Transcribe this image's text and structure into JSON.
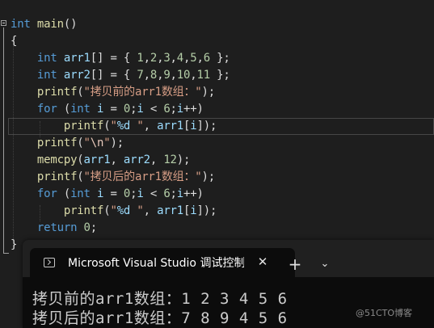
{
  "editor": {
    "lines": [
      [
        {
          "t": "int",
          "c": "kw"
        },
        {
          "t": " "
        },
        {
          "t": "main",
          "c": "fn"
        },
        {
          "t": "()"
        }
      ],
      [
        {
          "t": "{"
        }
      ],
      [
        {
          "t": "    "
        },
        {
          "t": "int",
          "c": "kw"
        },
        {
          "t": " "
        },
        {
          "t": "arr1",
          "c": "var"
        },
        {
          "t": "[] = { "
        },
        {
          "t": "1",
          "c": "num"
        },
        {
          "t": ","
        },
        {
          "t": "2",
          "c": "num"
        },
        {
          "t": ","
        },
        {
          "t": "3",
          "c": "num"
        },
        {
          "t": ","
        },
        {
          "t": "4",
          "c": "num"
        },
        {
          "t": ","
        },
        {
          "t": "5",
          "c": "num"
        },
        {
          "t": ","
        },
        {
          "t": "6",
          "c": "num"
        },
        {
          "t": " };"
        }
      ],
      [
        {
          "t": "    "
        },
        {
          "t": "int",
          "c": "kw"
        },
        {
          "t": " "
        },
        {
          "t": "arr2",
          "c": "var"
        },
        {
          "t": "[] = { "
        },
        {
          "t": "7",
          "c": "num"
        },
        {
          "t": ","
        },
        {
          "t": "8",
          "c": "num"
        },
        {
          "t": ","
        },
        {
          "t": "9",
          "c": "num"
        },
        {
          "t": ","
        },
        {
          "t": "10",
          "c": "num"
        },
        {
          "t": ","
        },
        {
          "t": "11",
          "c": "num"
        },
        {
          "t": " };"
        }
      ],
      [
        {
          "t": "    "
        },
        {
          "t": "printf",
          "c": "fn"
        },
        {
          "t": "("
        },
        {
          "t": "\"拷贝前的arr1数组：\"",
          "c": "str"
        },
        {
          "t": ");"
        }
      ],
      [
        {
          "t": "    "
        },
        {
          "t": "for",
          "c": "kw"
        },
        {
          "t": " ("
        },
        {
          "t": "int",
          "c": "kw"
        },
        {
          "t": " "
        },
        {
          "t": "i",
          "c": "var"
        },
        {
          "t": " = "
        },
        {
          "t": "0",
          "c": "num"
        },
        {
          "t": ";"
        },
        {
          "t": "i",
          "c": "var"
        },
        {
          "t": " < "
        },
        {
          "t": "6",
          "c": "num"
        },
        {
          "t": ";"
        },
        {
          "t": "i",
          "c": "var"
        },
        {
          "t": "++)"
        }
      ],
      [
        {
          "t": "        "
        },
        {
          "t": "printf",
          "c": "fn"
        },
        {
          "t": "("
        },
        {
          "t": "\"",
          "c": "str"
        },
        {
          "t": "%d",
          "c": "fmt"
        },
        {
          "t": " \"",
          "c": "str"
        },
        {
          "t": ", "
        },
        {
          "t": "arr1",
          "c": "var"
        },
        {
          "t": "["
        },
        {
          "t": "i",
          "c": "var"
        },
        {
          "t": "]);"
        }
      ],
      [
        {
          "t": "    "
        },
        {
          "t": "printf",
          "c": "fn"
        },
        {
          "t": "("
        },
        {
          "t": "\"",
          "c": "str"
        },
        {
          "t": "\\n",
          "c": "esc"
        },
        {
          "t": "\"",
          "c": "str"
        },
        {
          "t": ");"
        }
      ],
      [
        {
          "t": "    "
        },
        {
          "t": "memcpy",
          "c": "fn"
        },
        {
          "t": "("
        },
        {
          "t": "arr1",
          "c": "var"
        },
        {
          "t": ", "
        },
        {
          "t": "arr2",
          "c": "var"
        },
        {
          "t": ", "
        },
        {
          "t": "12",
          "c": "num"
        },
        {
          "t": ");"
        }
      ],
      [
        {
          "t": "    "
        },
        {
          "t": "printf",
          "c": "fn"
        },
        {
          "t": "("
        },
        {
          "t": "\"拷贝后的arr1数组：\"",
          "c": "str"
        },
        {
          "t": ");"
        }
      ],
      [
        {
          "t": "    "
        },
        {
          "t": "for",
          "c": "kw"
        },
        {
          "t": " ("
        },
        {
          "t": "int",
          "c": "kw"
        },
        {
          "t": " "
        },
        {
          "t": "i",
          "c": "var"
        },
        {
          "t": " = "
        },
        {
          "t": "0",
          "c": "num"
        },
        {
          "t": ";"
        },
        {
          "t": "i",
          "c": "var"
        },
        {
          "t": " < "
        },
        {
          "t": "6",
          "c": "num"
        },
        {
          "t": ";"
        },
        {
          "t": "i",
          "c": "var"
        },
        {
          "t": "++)"
        }
      ],
      [
        {
          "t": "        "
        },
        {
          "t": "printf",
          "c": "fn"
        },
        {
          "t": "("
        },
        {
          "t": "\"",
          "c": "str"
        },
        {
          "t": "%d",
          "c": "fmt"
        },
        {
          "t": " \"",
          "c": "str"
        },
        {
          "t": ", "
        },
        {
          "t": "arr1",
          "c": "var"
        },
        {
          "t": "["
        },
        {
          "t": "i",
          "c": "var"
        },
        {
          "t": "]);"
        }
      ],
      [
        {
          "t": "    "
        },
        {
          "t": "return",
          "c": "kw"
        },
        {
          "t": " "
        },
        {
          "t": "0",
          "c": "num"
        },
        {
          "t": ";"
        }
      ],
      [
        {
          "t": "}"
        }
      ]
    ]
  },
  "terminal": {
    "tab_title": "Microsoft Visual Studio 调试控制台",
    "close_glyph": "✕",
    "new_tab_glyph": "+",
    "dropdown_glyph": "⌄",
    "output_lines": [
      "拷贝前的arr1数组：1 2 3 4 5 6",
      "拷贝后的arr1数组：7 8 9 4 5 6"
    ]
  },
  "watermark": "@51CTO博客",
  "colors": {
    "editor_bg": "#1e1e1e",
    "keyword": "#569cd6",
    "function": "#dcdcaa",
    "variable": "#9cdcfe",
    "number": "#b5cea8",
    "string": "#d69d85",
    "terminal_bg": "#0c0c0c",
    "titlebar_bg": "#202020"
  }
}
